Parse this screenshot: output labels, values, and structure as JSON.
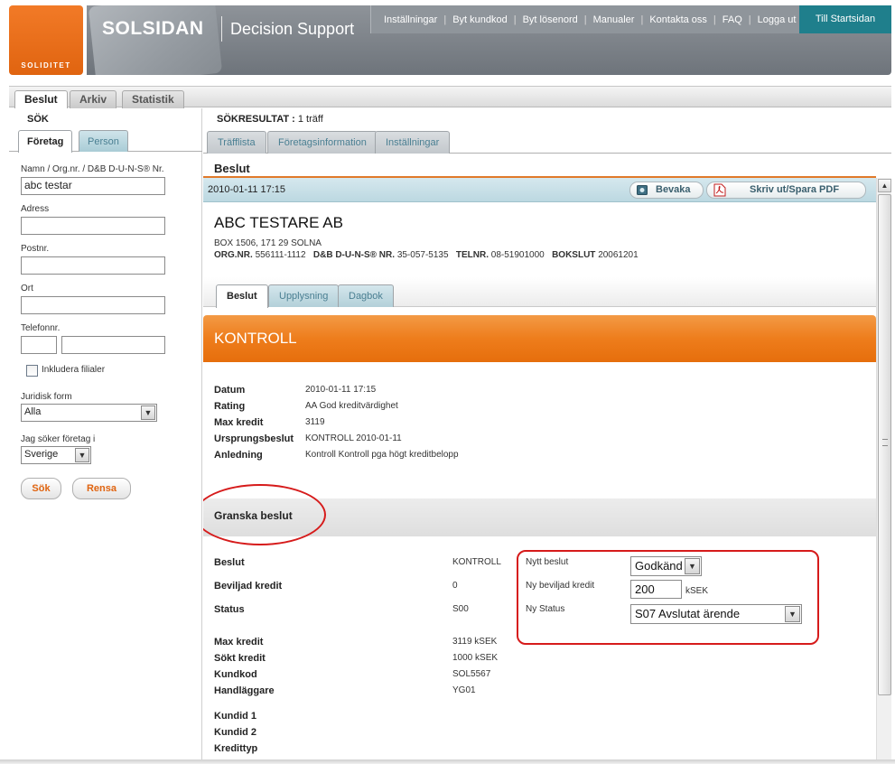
{
  "header": {
    "logo_text": "SOLIDITET",
    "brand": "SOLSIDAN",
    "subtitle": "Decision Support",
    "nav": [
      "Inställningar",
      "Byt kundkod",
      "Byt lösenord",
      "Manualer",
      "Kontakta oss",
      "FAQ",
      "Logga ut"
    ],
    "start_button": "Till Startsidan"
  },
  "main_tabs": [
    "Beslut",
    "Arkiv",
    "Statistik"
  ],
  "search": {
    "title": "SÖK",
    "tabs": [
      "Företag",
      "Person"
    ],
    "name_label": "Namn / Org.nr. / D&B D-U-N-S® Nr.",
    "name_value": "abc testar",
    "address_label": "Adress",
    "postnr_label": "Postnr.",
    "ort_label": "Ort",
    "phone_label": "Telefonnr.",
    "include_branches_label": "Inkludera filialer",
    "legal_form_label": "Juridisk form",
    "legal_form_value": "Alla",
    "country_label": "Jag söker företag i",
    "country_value": "Sverige",
    "search_button": "Sök",
    "clear_button": "Rensa"
  },
  "results": {
    "title_label": "SÖKRESULTAT :",
    "title_count": "1 träff",
    "tabs": [
      "Träfflista",
      "Företagsinformation",
      "Inställningar"
    ]
  },
  "decision": {
    "heading": "Beslut",
    "timestamp": "2010-01-11 17:15",
    "watch_button": "Bevaka",
    "pdf_button": "Skriv ut/Spara PDF",
    "company_name": "ABC TESTARE AB",
    "company_address": "BOX 1506, 171 29 SOLNA",
    "orgnr_label": "ORG.NR.",
    "orgnr_value": "556111-1112",
    "duns_label": "D&B D-U-N-S® NR.",
    "duns_value": "35-057-5135",
    "tel_label": "TELNR.",
    "tel_value": "08-51901000",
    "bokslut_label": "BOKSLUT",
    "bokslut_value": "20061201",
    "inner_tabs": [
      "Beslut",
      "Upplysning",
      "Dagbok"
    ],
    "status": "KONTROLL",
    "details": [
      {
        "label": "Datum",
        "value": "2010-01-11 17:15"
      },
      {
        "label": "Rating",
        "value": "AA God kreditvärdighet"
      },
      {
        "label": "Max kredit",
        "value": "3119"
      },
      {
        "label": "Ursprungsbeslut",
        "value": "KONTROLL 2010-01-11"
      },
      {
        "label": "Anledning",
        "value": "Kontroll Kontroll pga högt kreditbelopp"
      }
    ]
  },
  "review": {
    "title": "Granska beslut",
    "rows_a": [
      {
        "label": "Beslut",
        "value": "KONTROLL"
      },
      {
        "label": "Beviljad kredit",
        "value": "0"
      },
      {
        "label": "Status",
        "value": "S00"
      }
    ],
    "rows_b": [
      {
        "label": "Max kredit",
        "value": "3119 kSEK"
      },
      {
        "label": "Sökt kredit",
        "value": "1000 kSEK"
      },
      {
        "label": "Kundkod",
        "value": "SOL5567"
      },
      {
        "label": "Handläggare",
        "value": "YG01"
      }
    ],
    "rows_c": [
      {
        "label": "Kundid 1",
        "value": ""
      },
      {
        "label": "Kundid 2",
        "value": ""
      },
      {
        "label": "Kredittyp",
        "value": ""
      }
    ],
    "new_decision_label": "Nytt beslut",
    "new_decision_value": "Godkänd",
    "new_credit_label": "Ny beviljad kredit",
    "new_credit_value": "200",
    "new_credit_unit": "kSEK",
    "new_status_label": "Ny Status",
    "new_status_value": "S07 Avslutat ärende"
  },
  "colors": {
    "accent_orange": "#ee7d1c",
    "teal_button": "#1f7f8c",
    "highlight_red": "#d61b1b",
    "tab_blue_text": "#4a7f92"
  }
}
